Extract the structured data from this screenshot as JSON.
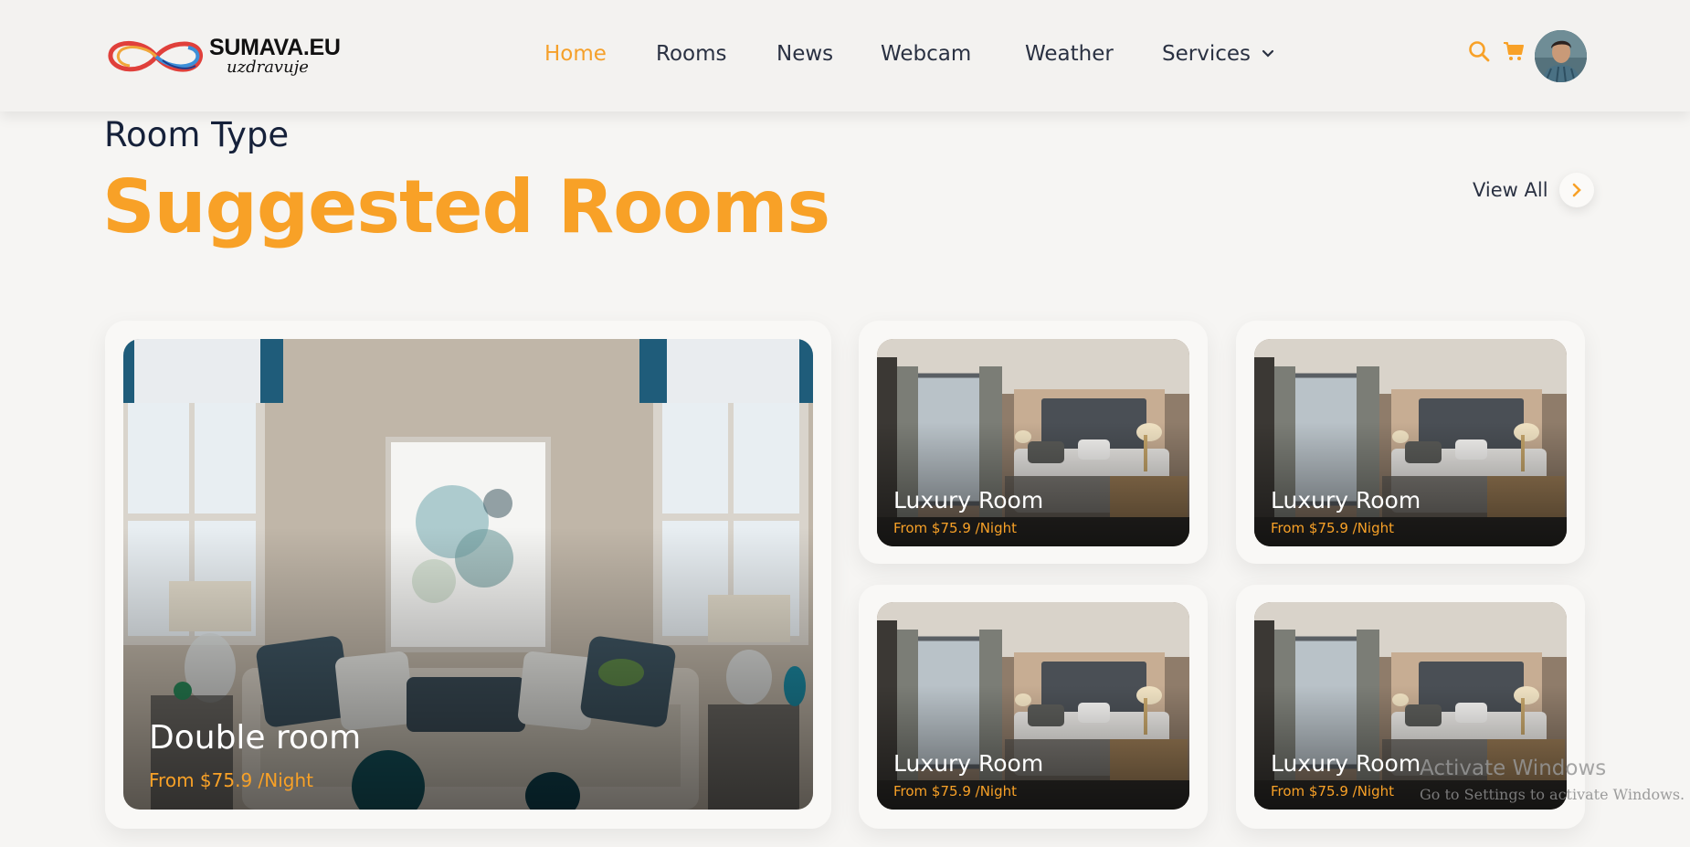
{
  "brand": {
    "name": "SUMAVA.EU",
    "tagline": "uzdravuje"
  },
  "nav": {
    "items": [
      {
        "label": "Home",
        "active": true
      },
      {
        "label": "Rooms",
        "active": false
      },
      {
        "label": "News",
        "active": false
      },
      {
        "label": "Webcam",
        "active": false
      },
      {
        "label": "Weather",
        "active": false
      },
      {
        "label": "Services",
        "active": false,
        "has_dropdown": true
      }
    ]
  },
  "header_icons": [
    "search-icon",
    "cart-icon",
    "avatar"
  ],
  "section": {
    "eyebrow": "Room Type",
    "title": "Suggested Rooms",
    "view_all_label": "View All"
  },
  "rooms": [
    {
      "name": "Double room",
      "price": "From $75.9 /Night"
    },
    {
      "name": "Luxury Room",
      "price": "From $75.9 /Night"
    },
    {
      "name": "Luxury Room",
      "price": "From $75.9 /Night"
    },
    {
      "name": "Luxury Room",
      "price": "From $75.9 /Night"
    },
    {
      "name": "Luxury Room",
      "price": "From $75.9 /Night"
    }
  ],
  "watermark": {
    "title": "Activate Windows",
    "subtitle": "Go to Settings to activate Windows."
  },
  "colors": {
    "accent": "#f8a127",
    "text_dark": "#16213a",
    "background": "#f6f5f3"
  }
}
